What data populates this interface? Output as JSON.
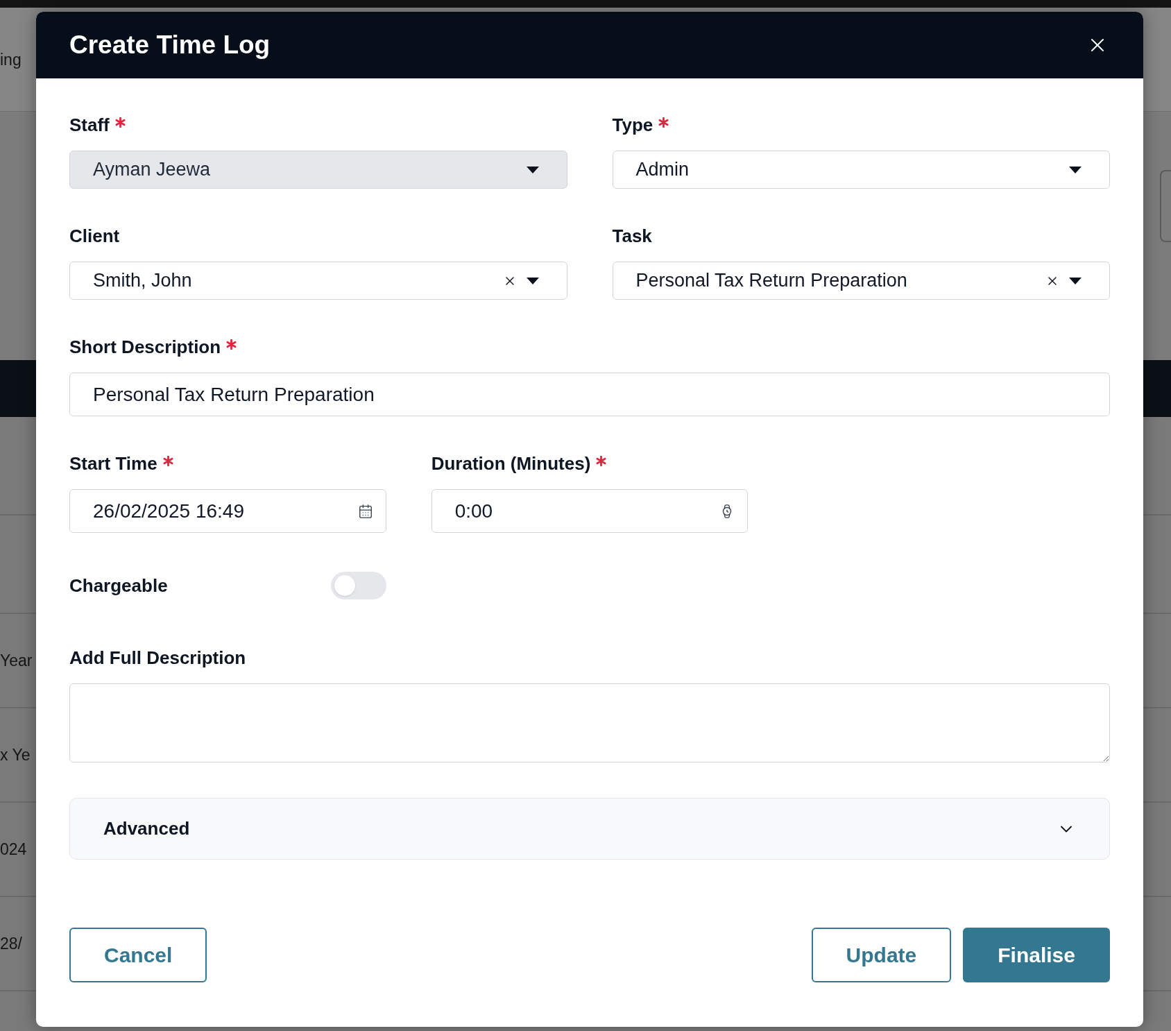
{
  "background_page": {
    "texts": [
      "ing",
      "Year",
      "x Ye",
      "024",
      "28/"
    ]
  },
  "dialog": {
    "title": "Create Time Log"
  },
  "rows": [
    [
      {
        "kind": "select",
        "label": "Staff",
        "required": true,
        "value": "Ayman Jeewa",
        "disabled": true,
        "clearable": false
      },
      {
        "kind": "select",
        "label": "Type",
        "required": true,
        "value": "Admin",
        "disabled": false,
        "clearable": false
      }
    ],
    [
      {
        "kind": "select",
        "label": "Client",
        "required": false,
        "value": "Smith, John",
        "disabled": false,
        "clearable": true
      },
      {
        "kind": "select",
        "label": "Task",
        "required": false,
        "value": "Personal Tax Return Preparation",
        "disabled": false,
        "clearable": true
      }
    ],
    [
      {
        "kind": "text",
        "label": "Short Description",
        "required": true,
        "value": "Personal Tax Return Preparation"
      }
    ],
    [
      {
        "kind": "date",
        "label": "Start Time",
        "required": true,
        "value": "26/02/2025 16:49"
      },
      {
        "kind": "duration",
        "label": "Duration (Minutes)",
        "required": true,
        "value": "0:00"
      }
    ],
    [
      {
        "kind": "toggle",
        "label": "Chargeable",
        "on": false
      }
    ],
    [
      {
        "kind": "textarea",
        "label": "Add Full Description",
        "required": false
      }
    ]
  ],
  "advanced": {
    "label": "Advanced",
    "expanded": false
  },
  "footer": {
    "left_buttons": [
      {
        "label": "Cancel",
        "kind": "outline"
      }
    ],
    "right_buttons": [
      {
        "label": "Update",
        "kind": "outline"
      },
      {
        "label": "Finalise",
        "kind": "primary"
      }
    ]
  }
}
